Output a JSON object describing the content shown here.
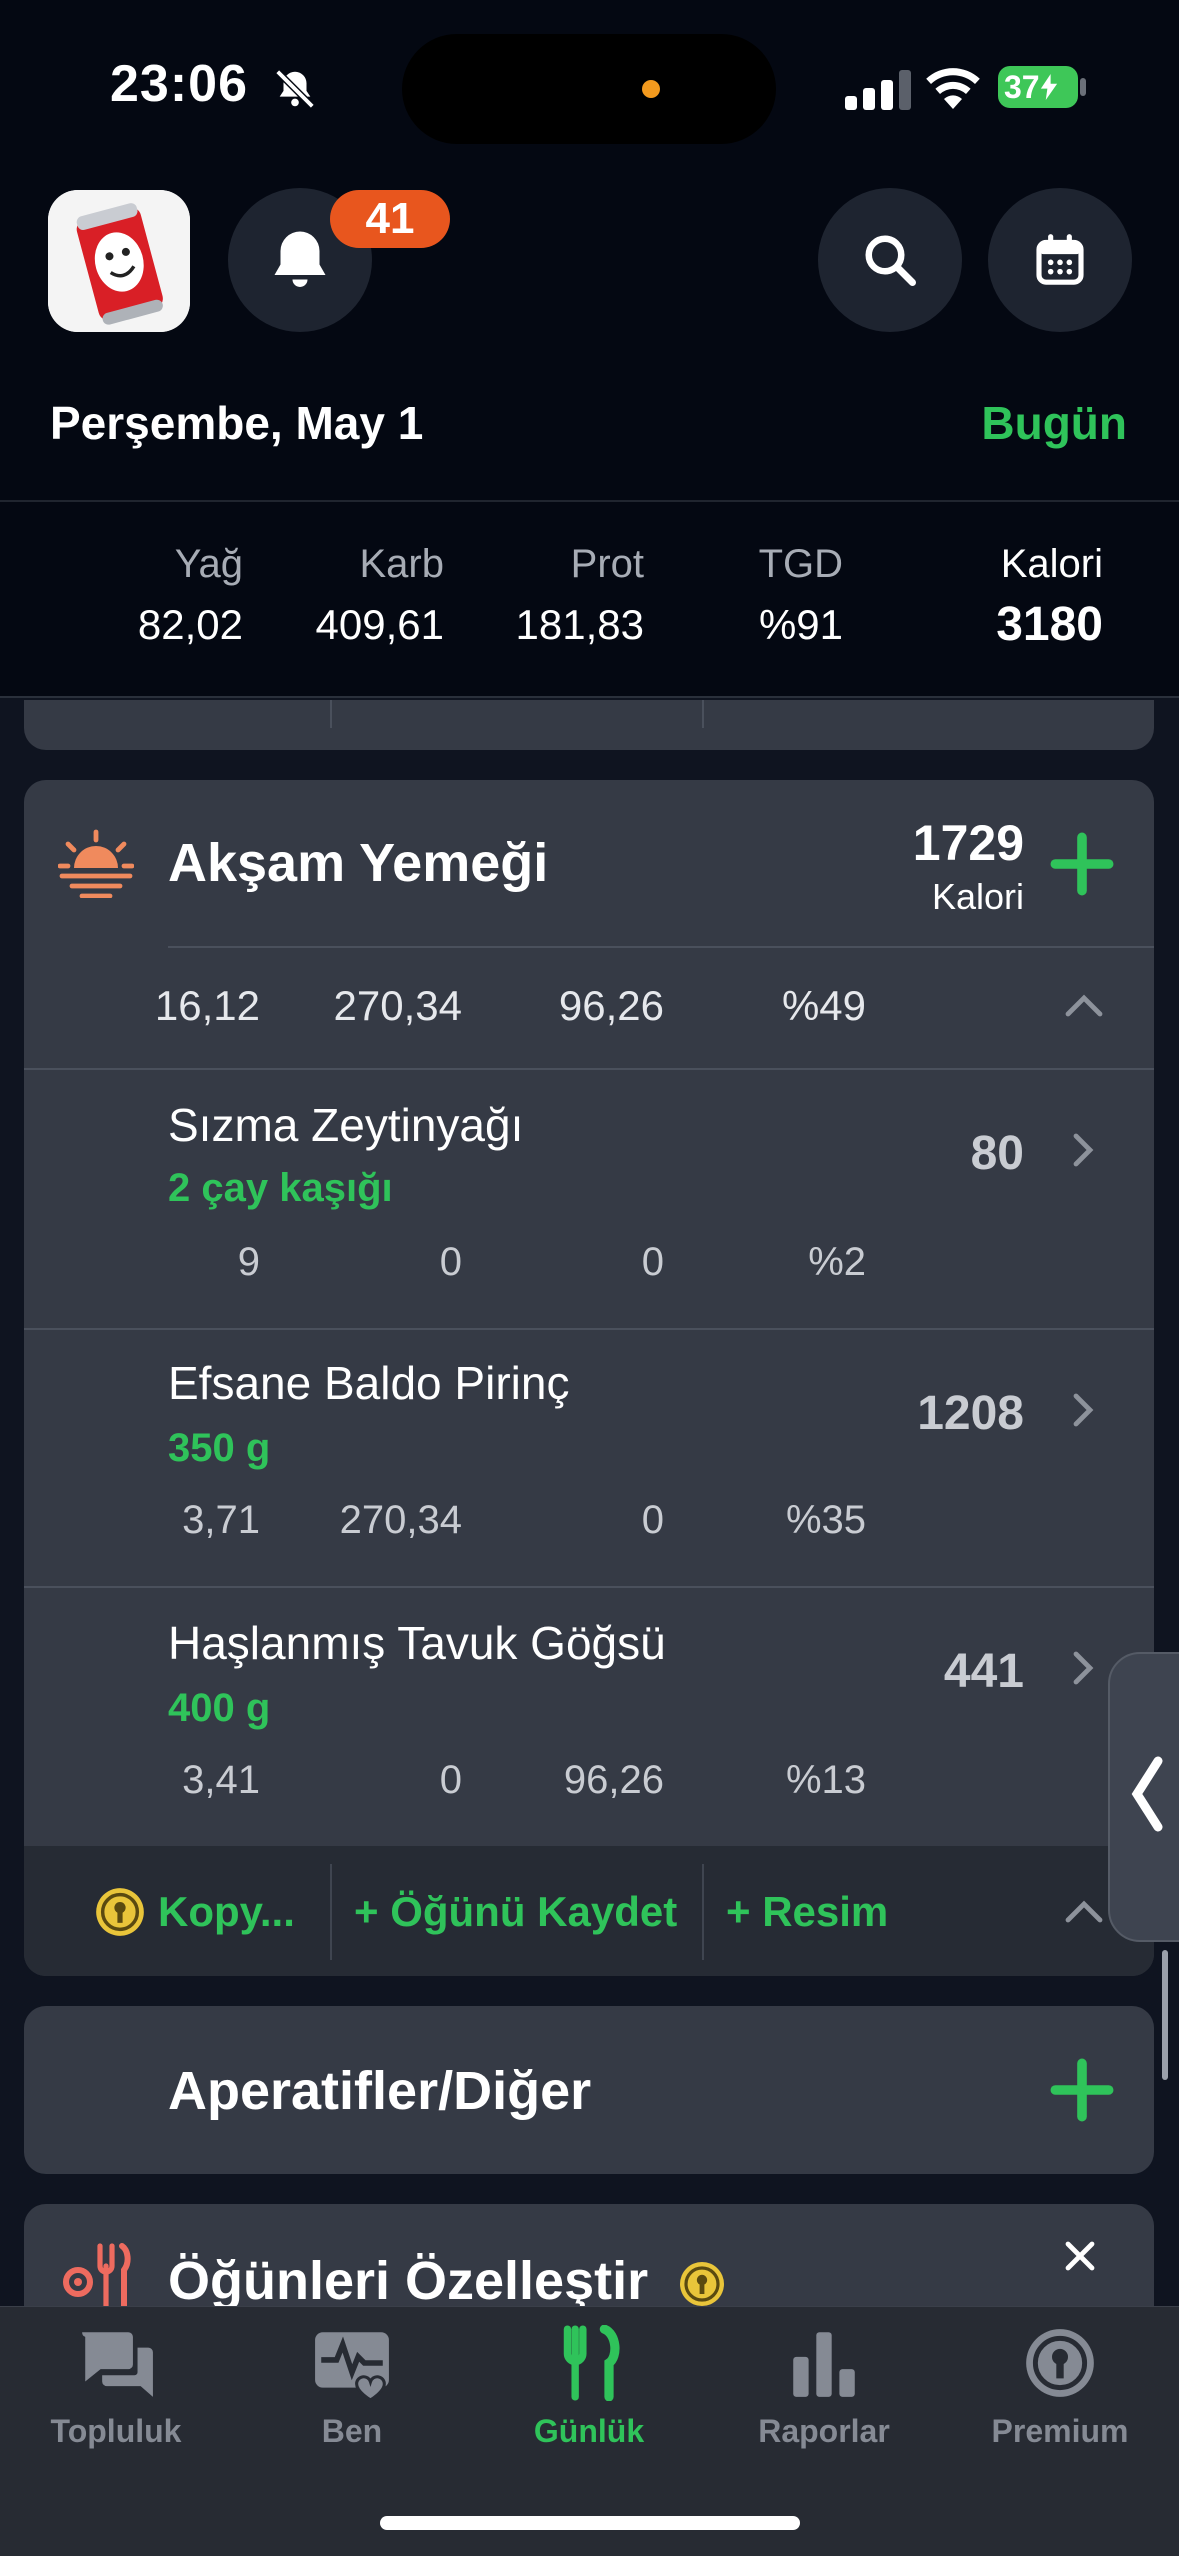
{
  "status_bar": {
    "time": "23:06",
    "battery": "37"
  },
  "header": {
    "notification_count": "41",
    "date": "Perşembe, May 1",
    "today_label": "Bugün"
  },
  "summary": {
    "labels": {
      "fat": "Yağ",
      "carb": "Karb",
      "prot": "Prot",
      "rdi": "TGD",
      "cal": "Kalori"
    },
    "values": {
      "fat": "82,02",
      "carb": "409,61",
      "prot": "181,83",
      "rdi": "%91",
      "cal": "3180"
    }
  },
  "dinner": {
    "title": "Akşam Yemeği",
    "calories": "1729",
    "calories_unit": "Kalori",
    "macros": {
      "fat": "16,12",
      "carb": "270,34",
      "prot": "96,26",
      "rdi": "%49"
    },
    "items": [
      {
        "name": "Sızma Zeytinyağı",
        "qty": "2 çay kaşığı",
        "cal": "80",
        "fat": "9",
        "carb": "0",
        "prot": "0",
        "rdi": "%2"
      },
      {
        "name": "Efsane Baldo Pirinç",
        "qty": "350 g",
        "cal": "1208",
        "fat": "3,71",
        "carb": "270,34",
        "prot": "0",
        "rdi": "%35"
      },
      {
        "name": "Haşlanmış Tavuk Göğsü",
        "qty": "400 g",
        "cal": "441",
        "fat": "3,41",
        "carb": "0",
        "prot": "96,26",
        "rdi": "%13"
      }
    ],
    "footer": {
      "copy": "Kopy...",
      "save_meal": "+ Öğünü Kaydet",
      "add_photo": "+ Resim"
    }
  },
  "snacks": {
    "title": "Aperatifler/Diğer"
  },
  "customize": {
    "title": "Öğünleri Özelleştir"
  },
  "tabs": [
    {
      "label": "Topluluk"
    },
    {
      "label": "Ben"
    },
    {
      "label": "Günlük"
    },
    {
      "label": "Raporlar"
    },
    {
      "label": "Premium"
    }
  ],
  "colors": {
    "accent": "#2fc35a",
    "badge": "#e8561e",
    "card": "#353a45",
    "background": "#0f1420"
  }
}
